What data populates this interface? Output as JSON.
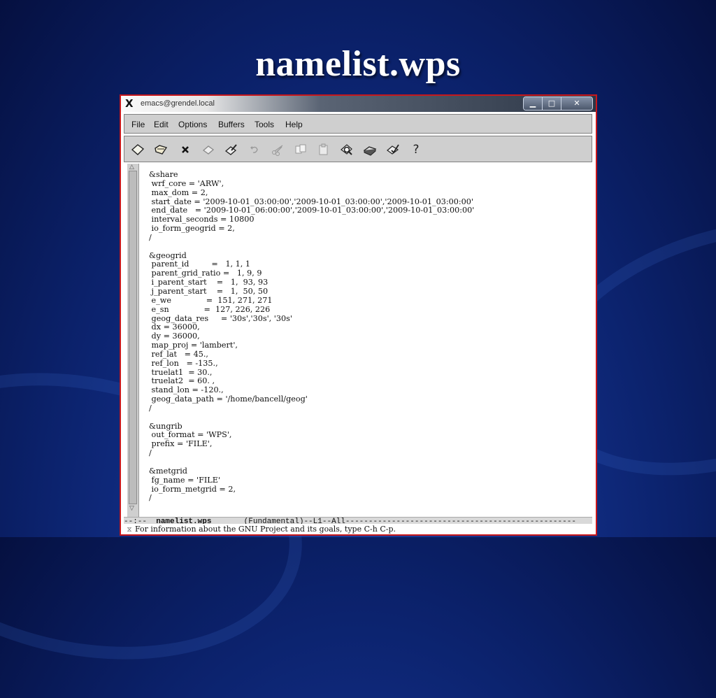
{
  "slide": {
    "title": "namelist.wps"
  },
  "window": {
    "title": "emacs@grendel.local",
    "buttons": {
      "minimize": "▁",
      "maximize": "□",
      "close": "✕"
    }
  },
  "menubar": {
    "items": [
      "File",
      "Edit",
      "Options",
      "Buffers",
      "Tools",
      "Help"
    ]
  },
  "toolbar": {
    "icons": [
      "new-file-icon",
      "open-folder-icon",
      "close-buffer-icon",
      "save-icon",
      "save-as-icon",
      "undo-icon",
      "cut-icon",
      "copy-icon",
      "paste-icon",
      "search-icon",
      "print-icon",
      "preferences-icon",
      "help-icon"
    ]
  },
  "editor": {
    "lines": [
      "&share",
      " wrf_core = 'ARW',",
      " max_dom = 2,",
      " start_date = '2009-10-01_03:00:00','2009-10-01_03:00:00','2009-10-01_03:00:00'",
      " end_date   = '2009-10-01_06:00:00','2009-10-01_03:00:00','2009-10-01_03:00:00'",
      " interval_seconds = 10800",
      " io_form_geogrid = 2,",
      "/",
      "",
      "&geogrid",
      " parent_id         =   1, 1, 1",
      " parent_grid_ratio =   1, 9, 9",
      " i_parent_start    =   1,  93, 93",
      " j_parent_start    =   1,  50, 50",
      " e_we              =  151, 271, 271",
      " e_sn              =  127, 226, 226",
      " geog_data_res     = '30s','30s', '30s'",
      " dx = 36000,",
      " dy = 36000,",
      " map_proj = 'lambert',",
      " ref_lat   = 45.,",
      " ref_lon   = -135.,",
      " truelat1  = 30.,",
      " truelat2  = 60. ,",
      " stand_lon = -120.,",
      " geog_data_path = '/home/bancell/geog'",
      "/",
      "",
      "&ungrib",
      " out_format = 'WPS',",
      " prefix = 'FILE',",
      "/",
      "",
      "&metgrid",
      " fg_name = 'FILE'",
      " io_form_metgrid = 2,",
      "/"
    ]
  },
  "modeline": {
    "prefix": "--:--  ",
    "buffer": "namelist.wps",
    "rest": "       (Fundamental)--L1--All--------------------------------------------------"
  },
  "minibuffer": {
    "text": "For information about the GNU Project and its goals, type C-h C-p."
  }
}
